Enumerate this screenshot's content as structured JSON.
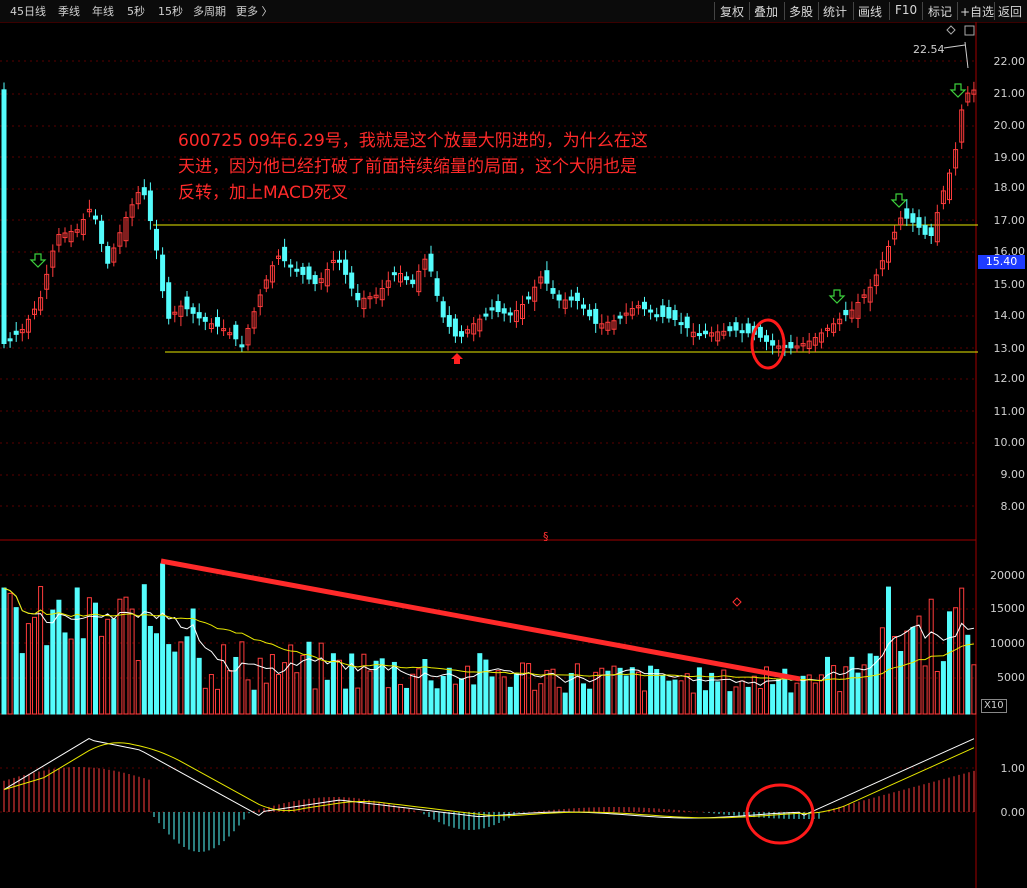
{
  "toolbar": {
    "left_items": [
      "45日线",
      "季线",
      "年线",
      "5秒",
      "15秒",
      "多周期",
      "更多 〉"
    ],
    "right_items": [
      "复权",
      "叠加",
      "多股",
      "统计",
      "画线",
      "F10",
      "标记",
      "+自选",
      "返回"
    ]
  },
  "annotation": {
    "line1": "600725 09年6.29号，我就是这个放量大阴进的，为什么在这",
    "line2": "天进，因为他已经打破了前面持续缩量的局面，这个大阴也是",
    "line3": "反转，加上MACD死叉"
  },
  "price_axis": [
    "22.00",
    "21.00",
    "20.00",
    "19.00",
    "18.00",
    "17.00",
    "16.00",
    "15.00",
    "14.00",
    "13.00",
    "12.00",
    "11.00",
    "10.00",
    "9.00",
    "8.00"
  ],
  "current_price": "15.40",
  "peak_label": "22.54",
  "volume_axis": [
    "20000",
    "15000",
    "10000",
    "5000"
  ],
  "volume_scale": "X10",
  "macd_axis": [
    "1.00",
    "0.00"
  ],
  "section_marker": "§",
  "colors": {
    "up": "#ff3c3c",
    "down": "#54fcfc",
    "ma_white": "#ffffff",
    "ma_yellow": "#e8e800",
    "trend_line": "#ff2a2a",
    "axis": "#a00000",
    "price_tag": "#1e3cff"
  }
}
